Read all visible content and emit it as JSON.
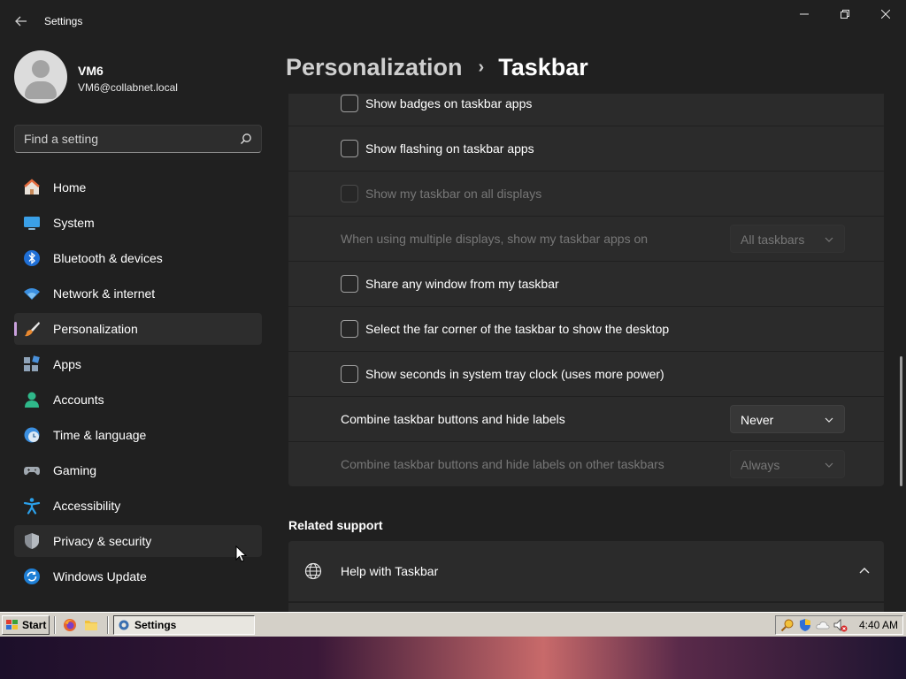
{
  "window": {
    "title": "Settings"
  },
  "profile": {
    "name": "VM6",
    "email": "VM6@collabnet.local"
  },
  "search": {
    "placeholder": "Find a setting"
  },
  "sidebar": {
    "items": [
      {
        "label": "Home",
        "icon": "home-icon"
      },
      {
        "label": "System",
        "icon": "system-icon"
      },
      {
        "label": "Bluetooth & devices",
        "icon": "bluetooth-icon"
      },
      {
        "label": "Network & internet",
        "icon": "wifi-icon"
      },
      {
        "label": "Personalization",
        "icon": "brush-icon",
        "selected": true
      },
      {
        "label": "Apps",
        "icon": "apps-icon"
      },
      {
        "label": "Accounts",
        "icon": "accounts-icon"
      },
      {
        "label": "Time & language",
        "icon": "clock-globe-icon"
      },
      {
        "label": "Gaming",
        "icon": "gamepad-icon"
      },
      {
        "label": "Accessibility",
        "icon": "accessibility-icon"
      },
      {
        "label": "Privacy & security",
        "icon": "shield-icon"
      },
      {
        "label": "Windows Update",
        "icon": "update-icon"
      }
    ]
  },
  "breadcrumb": {
    "parent": "Personalization",
    "separator": "›",
    "current": "Taskbar"
  },
  "settings": {
    "badges": {
      "label": "Show badges on taskbar apps",
      "checked": false
    },
    "flashing": {
      "label": "Show flashing on taskbar apps",
      "checked": false
    },
    "all_displays": {
      "label": "Show my taskbar on all displays",
      "checked": false,
      "disabled": true
    },
    "multi_display": {
      "label": "When using multiple displays, show my taskbar apps on",
      "value": "All taskbars",
      "disabled": true
    },
    "share_window": {
      "label": "Share any window from my taskbar",
      "checked": false
    },
    "far_corner": {
      "label": "Select the far corner of the taskbar to show the desktop",
      "checked": false
    },
    "seconds": {
      "label": "Show seconds in system tray clock (uses more power)",
      "checked": false
    },
    "combine": {
      "label": "Combine taskbar buttons and hide labels",
      "value": "Never"
    },
    "combine_other": {
      "label": "Combine taskbar buttons and hide labels on other taskbars",
      "value": "Always",
      "disabled": true
    }
  },
  "related": {
    "title": "Related support",
    "help_label": "Help with Taskbar"
  },
  "taskbar": {
    "start_label": "Start",
    "task_label": "Settings",
    "clock": "4:40 AM"
  },
  "colors": {
    "accent": "#c9a0dc",
    "background": "#202020",
    "card": "#2b2b2b",
    "taskbar": "#d4d0c8"
  }
}
